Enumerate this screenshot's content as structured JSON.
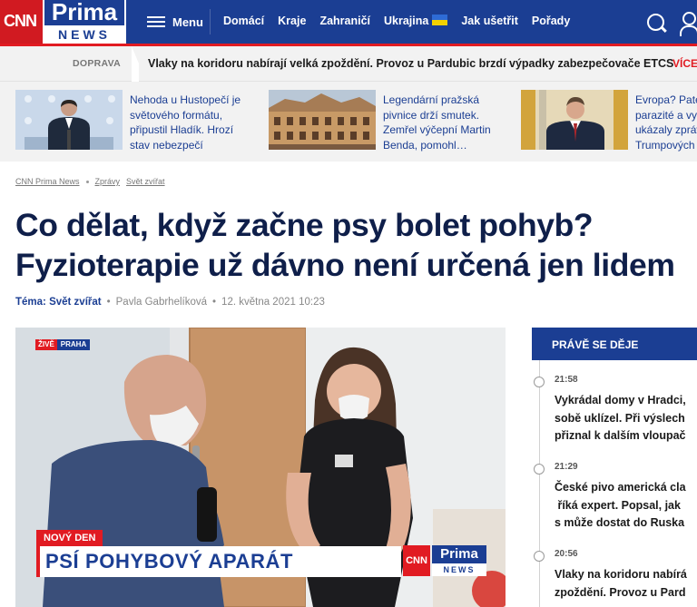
{
  "brand": {
    "cnn": "CNN",
    "prima": "Prima",
    "news": "NEWS"
  },
  "header": {
    "menu_label": "Menu",
    "nav": [
      "Domácí",
      "Kraje",
      "Zahraničí",
      "Ukrajina",
      "Jak ušetřit",
      "Pořady"
    ]
  },
  "ticker": {
    "label": "DOPRAVA",
    "text": "Vlaky na koridoru nabírají velká zpoždění. Provoz u Pardubic brzdí výpadky zabezpečovače ETCS",
    "more": "VÍCE"
  },
  "teasers": [
    {
      "text": "Nehoda u Hustopečí je světového formátu, připustil Hladík. Hrozí stav nebezpečí"
    },
    {
      "text": "Legendární pražská pivnice drží smutek. Zemřel výčepní Martin Benda, pomohl…"
    },
    {
      "text": "Evropa? Patetičtí parazité a vyžírky, ukázaly zprávy Trumpových lidí"
    }
  ],
  "breadcrumb": [
    "CNN Prima News",
    "Zprávy",
    "Svět zvířat"
  ],
  "article": {
    "title": "Co dělat, když začne psy bolet pohyb? Fyzioterapie už dávno není určená jen lidem",
    "topic": "Téma: Svět zvířat",
    "author": "Pavla Gabrhelíková",
    "date": "12. května 2021 10:23"
  },
  "video": {
    "live": "ŽIVĚ",
    "city": "PRAHA",
    "show": "NOVÝ DEN",
    "caption": "PSÍ POHYBOVÝ APARÁT"
  },
  "live_feed": {
    "title": "PRÁVĚ SE DĚJE",
    "items": [
      {
        "time": "21:58",
        "text": "Vykrádal domy v Hradci, sobě uklízel. Při výslech přiznal k dalším vloupač"
      },
      {
        "time": "21:29",
        "text": "České pivo americká cla říká expert. Popsal, jak s může dostat do Ruska"
      },
      {
        "time": "20:56",
        "text": "Vlaky na koridoru nabírá zpoždění. Provoz u Pard"
      }
    ]
  },
  "colors": {
    "brand_blue": "#1b3e93",
    "brand_red": "#e11b22",
    "title_navy": "#0f1f4a"
  }
}
